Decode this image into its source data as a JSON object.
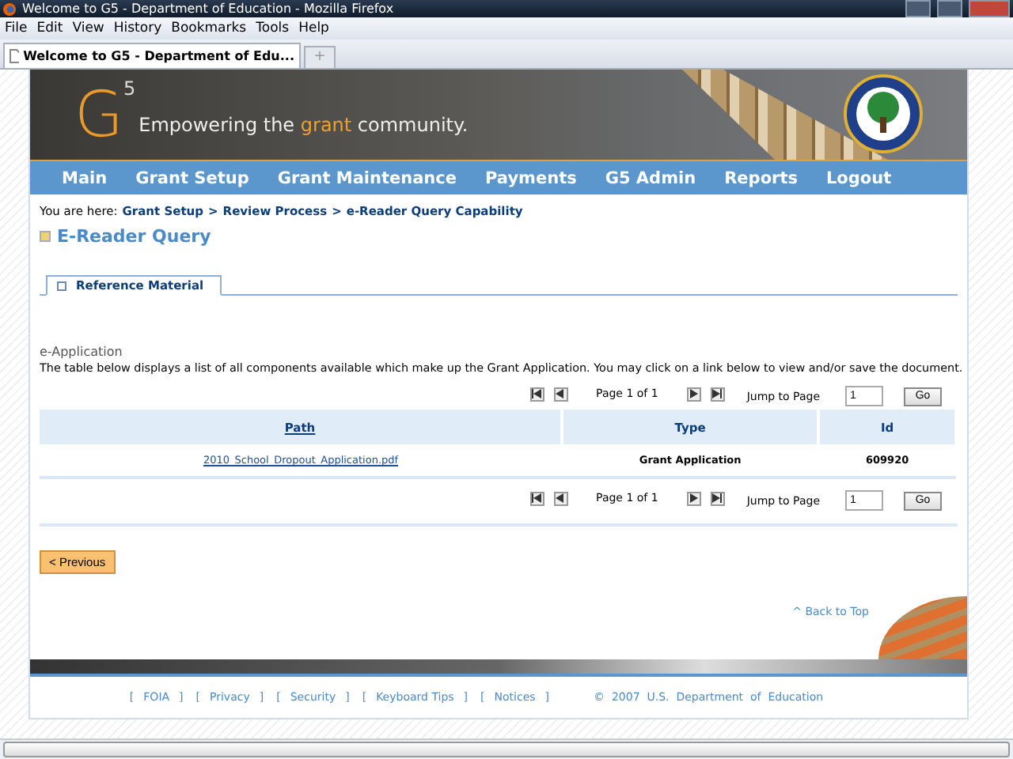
{
  "window": {
    "title": "Welcome to G5 - Department of Education - Mozilla Firefox"
  },
  "menu": [
    "File",
    "Edit",
    "View",
    "History",
    "Bookmarks",
    "Tools",
    "Help"
  ],
  "browser_tab": {
    "title": "Welcome to G5 - Department of Edu...",
    "new_tab": "+"
  },
  "banner": {
    "logo_letter": "G",
    "logo_number": "5",
    "tagline_before": "Empowering the ",
    "tagline_highlight": "grant",
    "tagline_after": " community."
  },
  "nav": [
    "Main",
    "Grant Setup",
    "Grant Maintenance",
    "Payments",
    "G5 Admin",
    "Reports",
    "Logout"
  ],
  "breadcrumb": {
    "label": "You are here:",
    "items": [
      "Grant Setup",
      "Review Process",
      "e-Reader Query Capability"
    ],
    "separator": ">"
  },
  "page_title": "E-Reader Query",
  "tabs": [
    {
      "label": "Reference Material",
      "selected": true
    }
  ],
  "section": {
    "title": "e-Application",
    "description": "The table below displays a list of all components available which make up the Grant Application. You may click on a link below to view and/or save the document."
  },
  "pager": {
    "page_text": "Page 1 of 1",
    "jump_label": "Jump to Page",
    "jump_value": "1",
    "go": "Go"
  },
  "table": {
    "columns": [
      {
        "label": "Path",
        "link": true
      },
      {
        "label": "Type",
        "link": false
      },
      {
        "label": "Id",
        "link": false
      }
    ],
    "rows": [
      [
        "2010_School_Dropout_Application.pdf",
        "Grant Application",
        "609920"
      ]
    ]
  },
  "pager_bottom": {
    "page_text": "Page 1 of 1",
    "jump_label": "Jump to Page",
    "jump_value": "1",
    "go": "Go"
  },
  "previous_button": "< Previous",
  "back_to_top": "^ Back to Top",
  "footer": {
    "bracket_open": "[",
    "bracket_close": "]",
    "links": [
      "FOIA",
      "Privacy",
      "Security",
      "Keyboard Tips",
      "Notices"
    ],
    "copyright": "©  2007  U.S.  Department  of  Education"
  }
}
